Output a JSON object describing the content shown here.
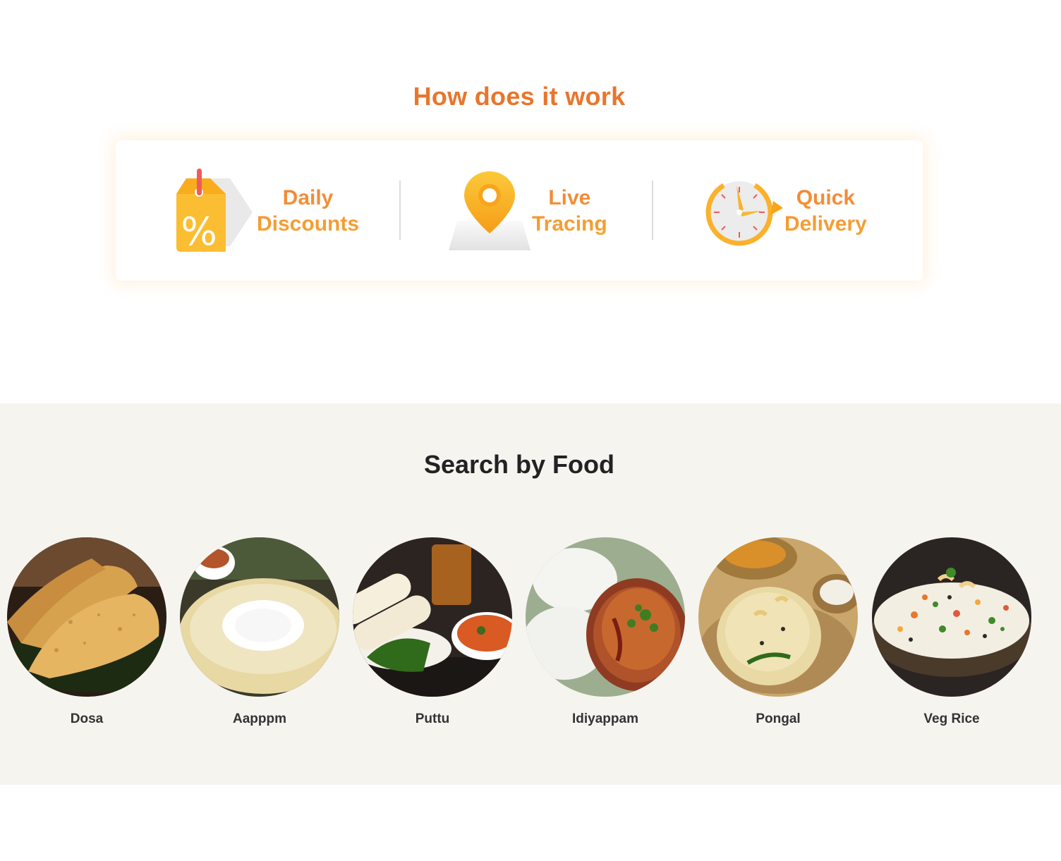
{
  "how_it_works": {
    "title": "How does it work",
    "features": [
      {
        "line1": "Daily",
        "line2": "Discounts",
        "icon": "discount-tag-icon"
      },
      {
        "line1": "Live",
        "line2": "Tracing",
        "icon": "location-pin-icon"
      },
      {
        "line1": "Quick",
        "line2": "Delivery",
        "icon": "clock-icon"
      }
    ]
  },
  "search_by_food": {
    "title": "Search by Food",
    "items": [
      {
        "label": "Dosa"
      },
      {
        "label": "Aapppm"
      },
      {
        "label": "Puttu"
      },
      {
        "label": "Idiyappam"
      },
      {
        "label": "Pongal"
      },
      {
        "label": "Veg Rice"
      }
    ]
  },
  "colors": {
    "accent_orange": "#e8762d",
    "accent_yellow": "#f6a531",
    "section_bg": "#f6f4ef"
  }
}
